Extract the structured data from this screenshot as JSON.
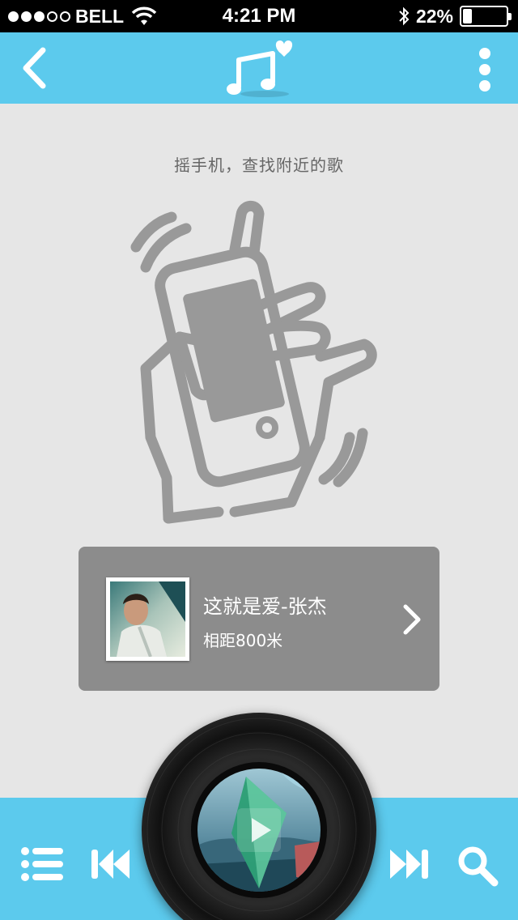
{
  "status_bar": {
    "carrier": "BELL",
    "time": "4:21 PM",
    "battery": "22%",
    "battery_level": 0.22
  },
  "header": {
    "back_icon": "chevron-left-icon",
    "logo_icon": "music-note-heart-icon",
    "more_icon": "vertical-dots-icon"
  },
  "main": {
    "prompt": "摇手机，查找附近的歌",
    "illustration": "hand-shaking-phone-icon"
  },
  "song_card": {
    "title": "这就是爱-张杰",
    "distance": "相距800米"
  },
  "player": {
    "playlist_icon": "playlist-icon",
    "prev_icon": "skip-previous-icon",
    "play_icon": "play-icon",
    "next_icon": "skip-next-icon",
    "search_icon": "search-icon"
  },
  "colors": {
    "accent": "#5ccaed",
    "background": "#e6e6e6",
    "card": "#8c8c8c",
    "illustration": "#999999"
  }
}
